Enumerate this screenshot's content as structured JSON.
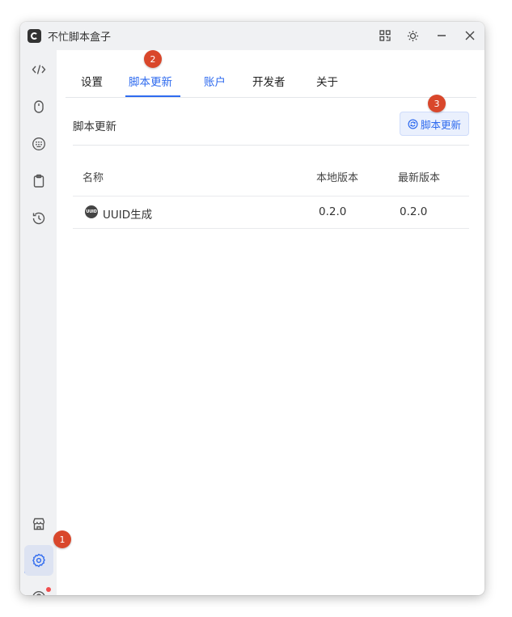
{
  "app": {
    "title": "不忙脚本盒子"
  },
  "tabs": [
    {
      "label": "设置"
    },
    {
      "label": "脚本更新"
    },
    {
      "label": "账户"
    },
    {
      "label": "开发者"
    },
    {
      "label": "关于"
    }
  ],
  "section": {
    "title": "脚本更新",
    "update_button": "脚本更新"
  },
  "table": {
    "headers": [
      "名称",
      "本地版本",
      "最新版本"
    ],
    "rows": [
      {
        "icon_text": "UUID",
        "name": "UUID生成",
        "local": "0.2.0",
        "latest": "0.2.0"
      }
    ]
  },
  "markers": [
    "1",
    "2",
    "3"
  ],
  "colors": {
    "accent": "#2f6bef",
    "marker": "#d9472b",
    "sidebar": "#f0f1f3",
    "dot": "#f04e4e"
  },
  "icons": {
    "sidebar": [
      "code-icon",
      "mouse-icon",
      "keypad-icon",
      "clipboard-icon",
      "history-icon",
      "store-icon",
      "settings-icon",
      "user-icon"
    ],
    "titlebar": [
      "qrcode-icon",
      "theme-icon",
      "minimize-icon",
      "close-icon"
    ]
  }
}
